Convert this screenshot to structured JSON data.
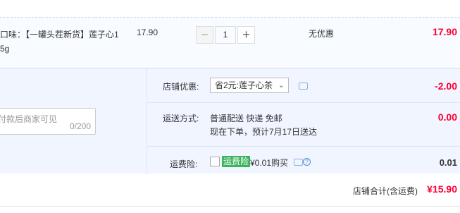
{
  "item": {
    "name": "口味：【一罐头茬新货】莲子心1\n5g",
    "unit_price": "17.90",
    "quantity": "1",
    "minus": "−",
    "plus": "+",
    "discount": "无优惠",
    "subtotal": "17.90"
  },
  "message": {
    "placeholder": "付款后商家可见",
    "count": "0/200"
  },
  "shop_discount": {
    "label": "店铺优惠:",
    "selected": "省2元:莲子心茶",
    "amount": "-2.00"
  },
  "shipping": {
    "label": "运送方式:",
    "method": "普通配送 快递 免邮",
    "eta": "现在下单，预计7月17日送达",
    "amount": "0.00"
  },
  "insurance": {
    "label": "运费险:",
    "badge": "运费险",
    "price": "¥0.01购买",
    "amount": "0.01"
  },
  "total": {
    "label": "店铺合计(含运费)",
    "amount": "¥15.90"
  },
  "colors": {
    "accent": "#ff0036",
    "panel_bg": "#f0f5ff",
    "badge": "#3cb35c"
  },
  "icons": [
    "chevron-down-icon",
    "chat-icon",
    "help-icon"
  ]
}
